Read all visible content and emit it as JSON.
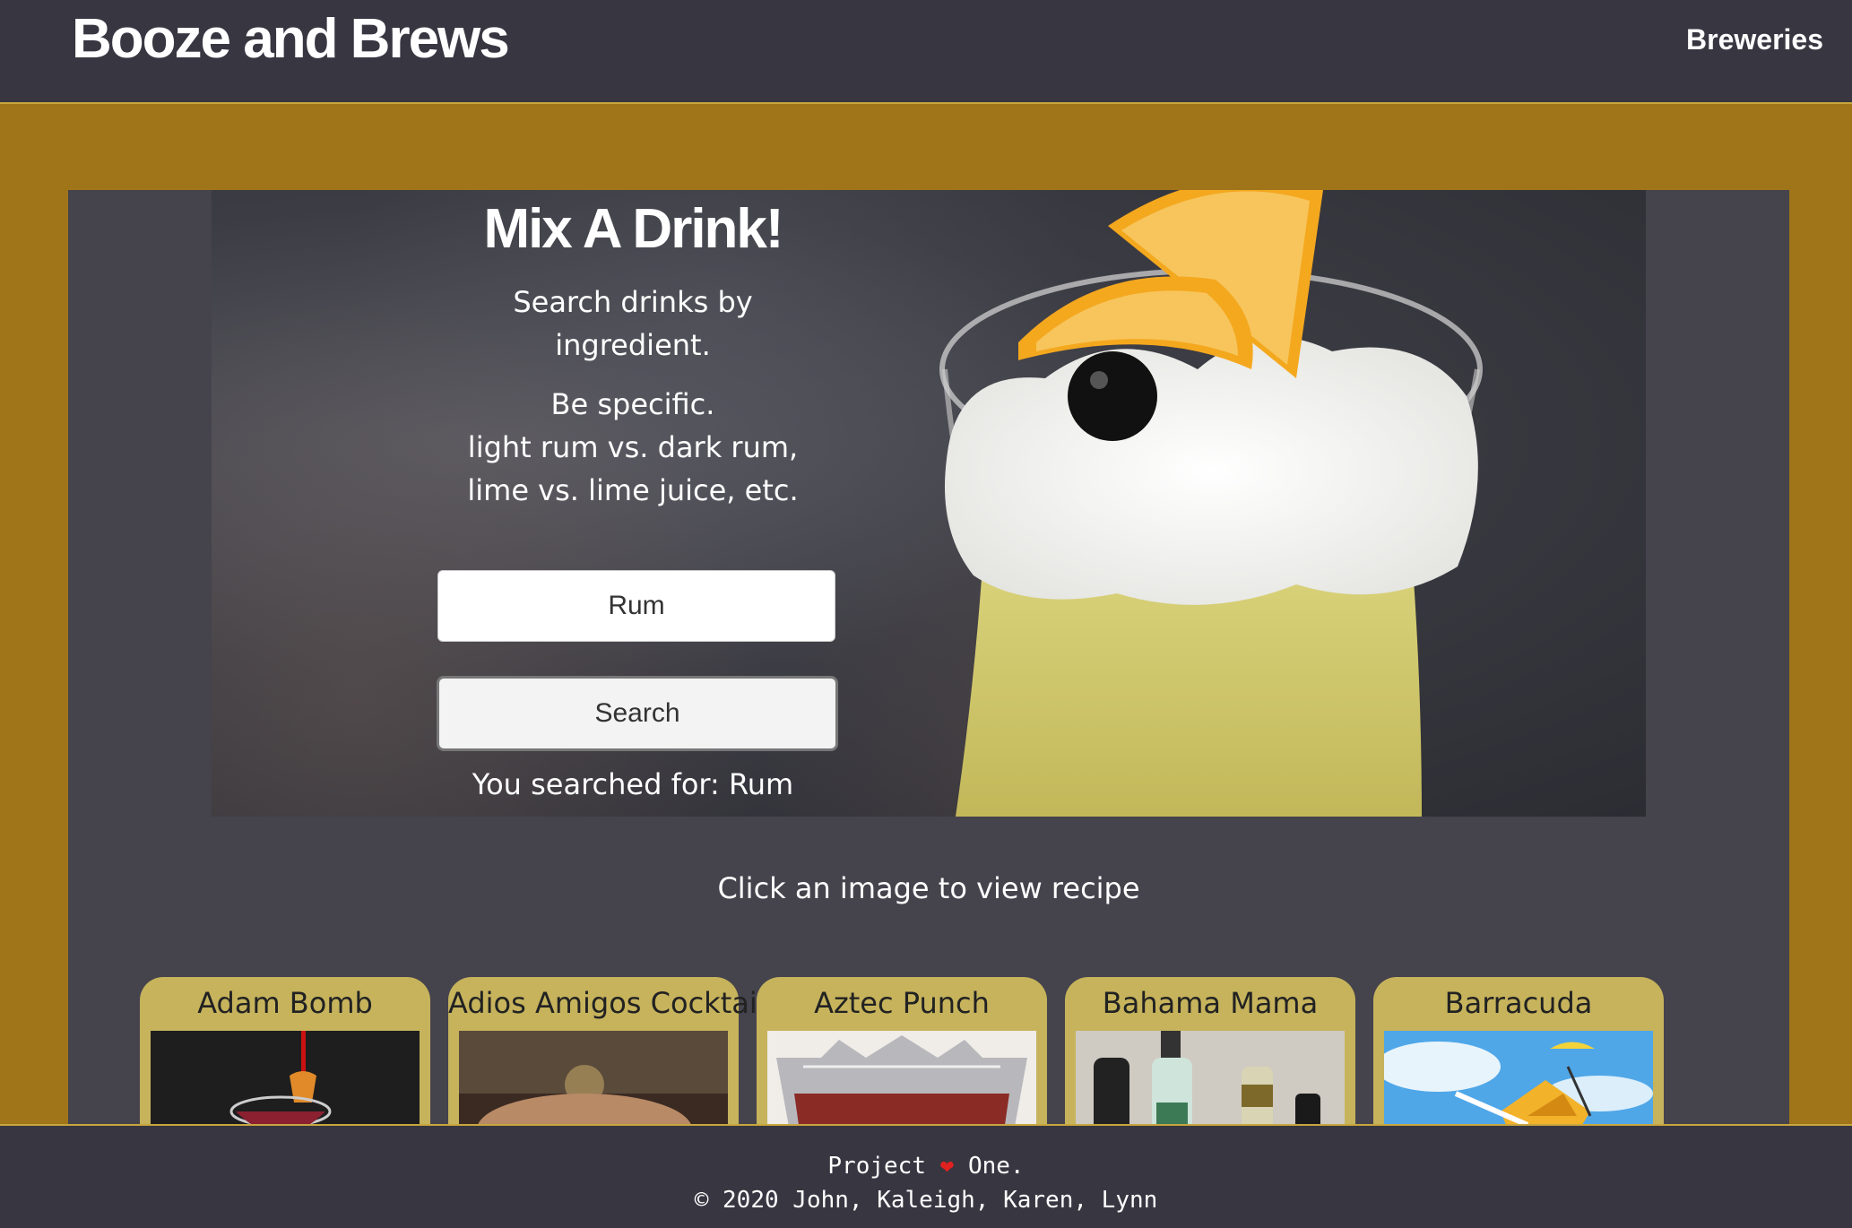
{
  "header": {
    "brand": "Booze and Brews",
    "nav_link": "Breweries"
  },
  "hero": {
    "title": "Mix A Drink!",
    "subtitle_line1": "Search drinks by",
    "subtitle_line2": "ingredient.",
    "note_line1": "Be specific.",
    "note_line2": "light rum vs. dark rum,",
    "note_line3": "lime vs. lime juice, etc.",
    "input_value": "Rum",
    "search_button": "Search",
    "searched_prefix": "You searched for: ",
    "searched_value": "Rum"
  },
  "results": {
    "hint": "Click an image to view recipe",
    "cards": [
      {
        "title": "Adam Bomb",
        "icon": "cocktail-image"
      },
      {
        "title": "Adios Amigos Cocktail",
        "icon": "cocktail-image"
      },
      {
        "title": "Aztec Punch",
        "icon": "punch-bowl-image"
      },
      {
        "title": "Bahama Mama",
        "icon": "bottles-image"
      },
      {
        "title": "Barracuda",
        "icon": "tropical-drink-image"
      }
    ]
  },
  "footer": {
    "line1_before": "Project ",
    "line1_after": " One.",
    "line2": "© 2020 John, Kaleigh, Karen, Lynn"
  },
  "colors": {
    "header_bg": "#383641",
    "page_bg": "#a07419",
    "panel_bg": "#45434c",
    "card_bg": "#c6b35c"
  }
}
